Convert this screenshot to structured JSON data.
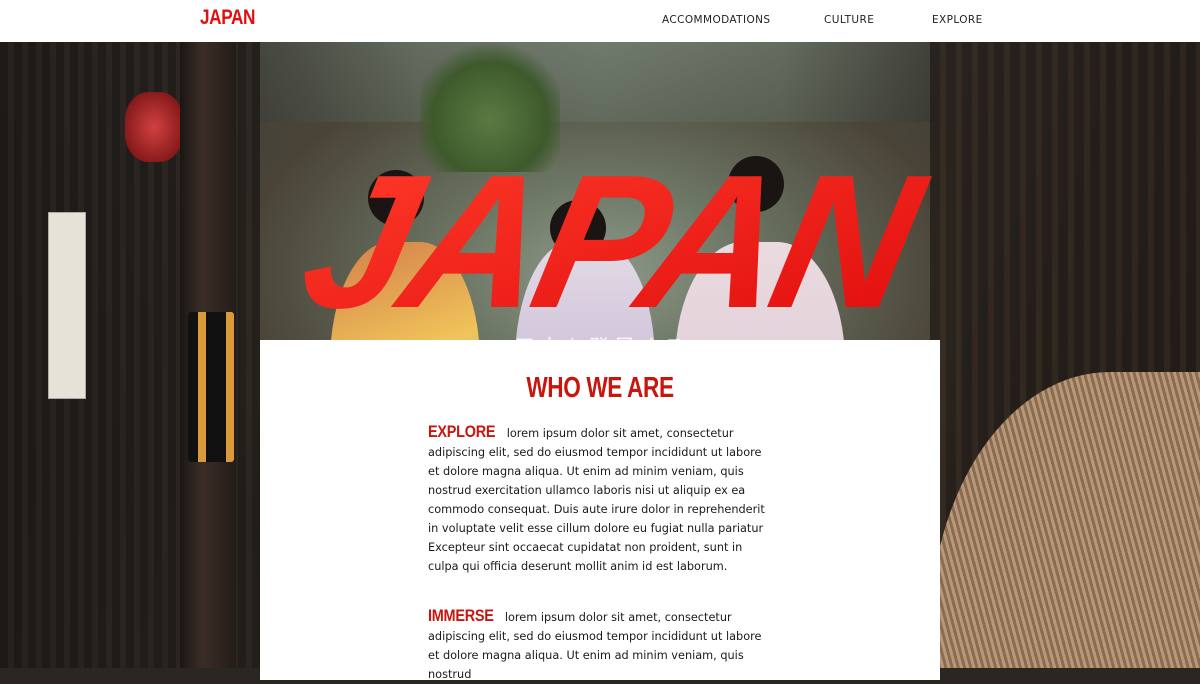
{
  "nav": {
    "brand": "JAPAN",
    "links": [
      "ACCOMMODATIONS",
      "CULTURE",
      "EXPLORE"
    ]
  },
  "hero": {
    "title": "JAPAN",
    "subtitle": "日本を発見する"
  },
  "about": {
    "heading": "WHO WE ARE",
    "sections": [
      {
        "keyword": "EXPLORE",
        "text": "lorem ipsum dolor sit amet, consectetur adipiscing elit, sed do eiusmod tempor incididunt ut labore et dolore magna aliqua. Ut enim ad minim veniam, quis nostrud exercitation ullamco laboris nisi ut aliquip ex ea commodo consequat. Duis aute irure dolor in reprehenderit in voluptate velit esse cillum dolore eu fugiat nulla pariatur Excepteur sint occaecat cupidatat non proident, sunt in culpa qui officia deserunt mollit anim id est laborum."
      },
      {
        "keyword": "IMMERSE",
        "text": "lorem ipsum dolor sit amet, consectetur adipiscing elit, sed do eiusmod tempor incididunt ut labore et dolore magna aliqua. Ut enim ad minim veniam, quis nostrud"
      }
    ]
  },
  "colors": {
    "accent": "#e01010",
    "heading_red": "#c8160f"
  }
}
